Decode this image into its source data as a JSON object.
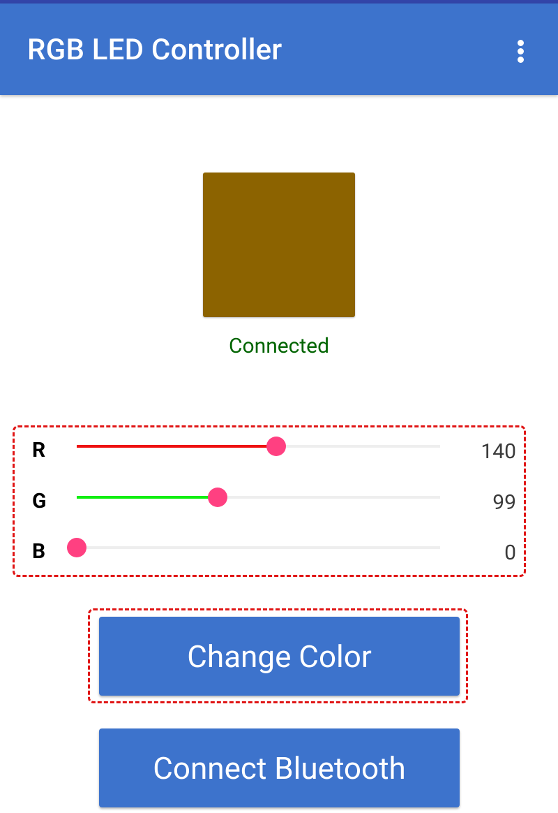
{
  "app": {
    "title": "RGB LED Controller"
  },
  "status": {
    "text": "Connected",
    "color": "#006400"
  },
  "swatch": {
    "color": "#8c6300"
  },
  "channels": [
    {
      "label": "R",
      "value": "140",
      "max": 255,
      "fill_color": "#ee1111"
    },
    {
      "label": "G",
      "value": "99",
      "max": 255,
      "fill_color": "#11ee11"
    },
    {
      "label": "B",
      "value": "0",
      "max": 255,
      "fill_color": "#1111ee"
    }
  ],
  "buttons": {
    "change_color": "Change Color",
    "connect_bluetooth": "Connect Bluetooth"
  },
  "colors": {
    "app_bar": "#3d73cc",
    "thumb": "#ff4081",
    "highlight_dashed": "#e01515"
  },
  "icons": {
    "menu": "overflow-menu-icon"
  }
}
